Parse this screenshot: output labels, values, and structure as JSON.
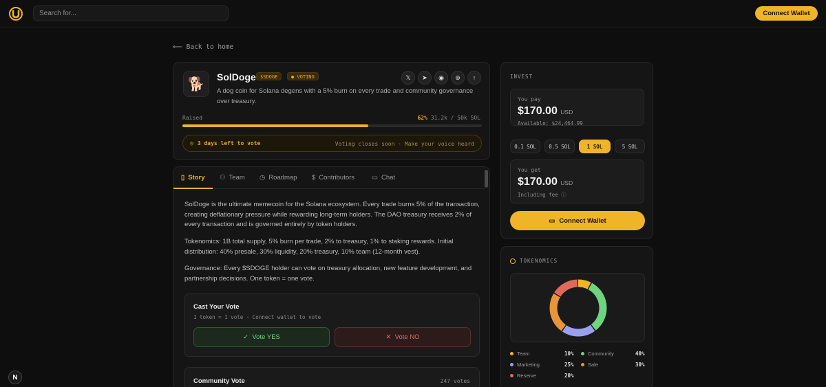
{
  "header": {
    "search_placeholder": "Search for...",
    "connect_label": "Connect Wallet"
  },
  "back_label": "Back to home",
  "project": {
    "name": "SolDoge",
    "ticker": "$SDOGE",
    "status": "VOTING",
    "description": "A dog coin for Solana degens with a 5% burn on every trade and community governance over treasury.",
    "socials": [
      "x-icon",
      "telegram-icon",
      "discord-icon",
      "globe-icon",
      "share-icon"
    ],
    "raised_label": "Raised",
    "raised_pct": "62%",
    "raised_amount": "31.2k / 50k SOL",
    "progress": 0.62,
    "vote_left": "3 days left to vote",
    "vote_note": "Voting closes soon · Make your voice heard"
  },
  "tabs": [
    {
      "label": "Story",
      "icon": "document-icon"
    },
    {
      "label": "Team",
      "icon": "users-icon"
    },
    {
      "label": "Roadmap",
      "icon": "clock-icon"
    },
    {
      "label": "Contributors",
      "icon": "dollar-icon"
    },
    {
      "label": "Chat",
      "icon": "chat-icon"
    }
  ],
  "story": {
    "p1": "SolDoge is the ultimate memecoin for the Solana ecosystem. Every trade burns 5% of the transaction, creating deflationary pressure while rewarding long-term holders. The DAO treasury receives 2% of every transaction and is governed entirely by token holders.",
    "p2": "Tokenomics: 1B total supply, 5% burn per trade, 2% to treasury, 1% to staking rewards. Initial distribution: 40% presale, 30% liquidity, 20% treasury, 10% team (12-month vest).",
    "p3": "Governance: Every $SDOGE holder can vote on treasury allocation, new feature development, and partnership decisions. One token = one vote."
  },
  "cast_vote": {
    "title": "Cast Your Vote",
    "subtitle": "1 token = 1 vote · Connect wallet to vote",
    "yes_label": "Vote YES",
    "no_label": "Vote NO"
  },
  "community_vote": {
    "title": "Community Vote",
    "count": "247 votes"
  },
  "invest": {
    "section_label": "INVEST",
    "pay_label": "You pay",
    "pay_amount": "$170.00",
    "currency": "USD",
    "available": "Available: $24,464.99",
    "amounts": [
      "0.1 SOL",
      "0.5 SOL",
      "1 SOL",
      "5 SOL"
    ],
    "selected_amount": "1 SOL",
    "get_label": "You get",
    "get_amount": "$170.00",
    "fee_note": "Including fee",
    "connect_label": "Connect Wallet"
  },
  "tokenomics": {
    "section_label": "TOKENOMICS",
    "items": [
      {
        "label": "Team",
        "pct": "10%",
        "value": 10,
        "color": "#f0b429"
      },
      {
        "label": "Community",
        "pct": "40%",
        "value": 40,
        "color": "#6fd37f"
      },
      {
        "label": "Marketing",
        "pct": "25%",
        "value": 25,
        "color": "#9aa0f0"
      },
      {
        "label": "Sale",
        "pct": "30%",
        "value": 30,
        "color": "#e8953a"
      },
      {
        "label": "Reserve",
        "pct": "20%",
        "value": 20,
        "color": "#e06a5a"
      }
    ]
  }
}
